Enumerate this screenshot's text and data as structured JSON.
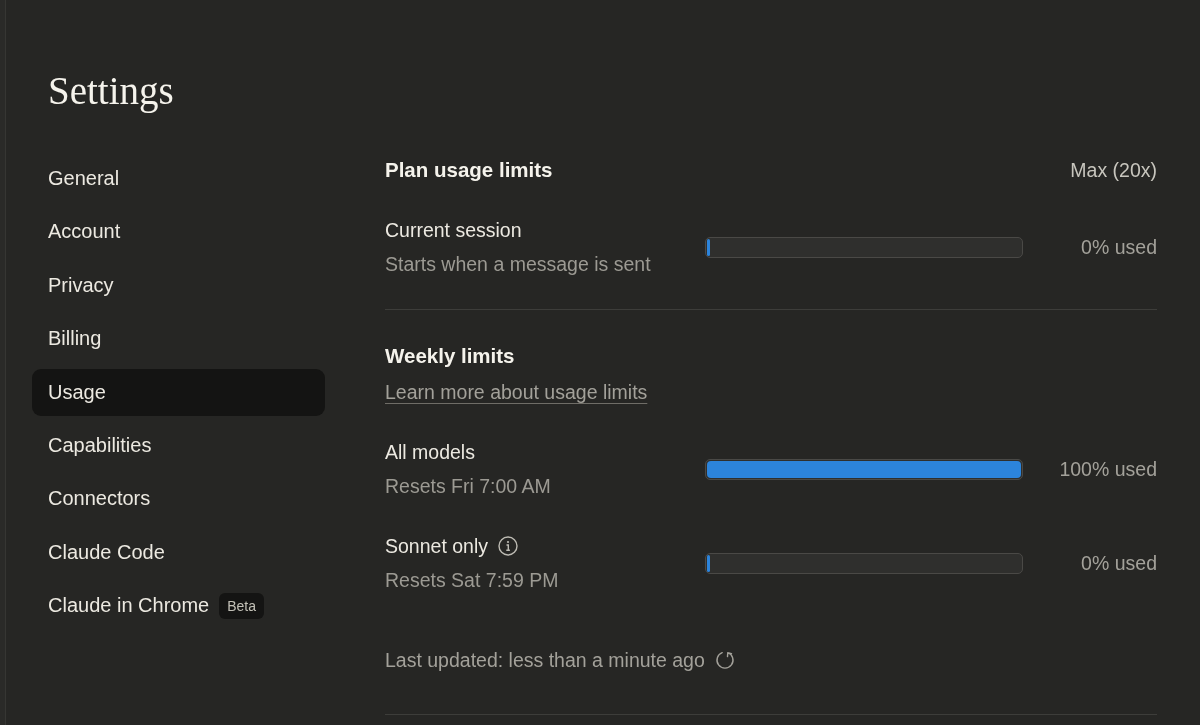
{
  "page": {
    "title": "Settings"
  },
  "sidebar": {
    "items": [
      {
        "label": "General",
        "selected": false
      },
      {
        "label": "Account",
        "selected": false
      },
      {
        "label": "Privacy",
        "selected": false
      },
      {
        "label": "Billing",
        "selected": false
      },
      {
        "label": "Usage",
        "selected": true
      },
      {
        "label": "Capabilities",
        "selected": false
      },
      {
        "label": "Connectors",
        "selected": false
      },
      {
        "label": "Claude Code",
        "selected": false
      },
      {
        "label": "Claude in Chrome",
        "selected": false,
        "badge": "Beta"
      }
    ]
  },
  "plan_usage": {
    "title": "Plan usage limits",
    "plan": "Max (20x)",
    "meters": [
      {
        "name": "Current session",
        "info": false,
        "detail": "Starts when a message is sent",
        "level": 0,
        "reading": "0% used"
      }
    ]
  },
  "weekly_limits": {
    "title": "Weekly limits",
    "link": "Learn more about usage limits",
    "meters": [
      {
        "name": "All models",
        "info": false,
        "detail": "Resets Fri 7:00 AM",
        "level": 1,
        "reading": "100% used"
      },
      {
        "name": "Sonnet only",
        "info": true,
        "detail": "Resets Sat 7:59 PM",
        "level": 0,
        "reading": "0% used"
      }
    ]
  },
  "last_updated": "Last updated: less than a minute ago"
}
